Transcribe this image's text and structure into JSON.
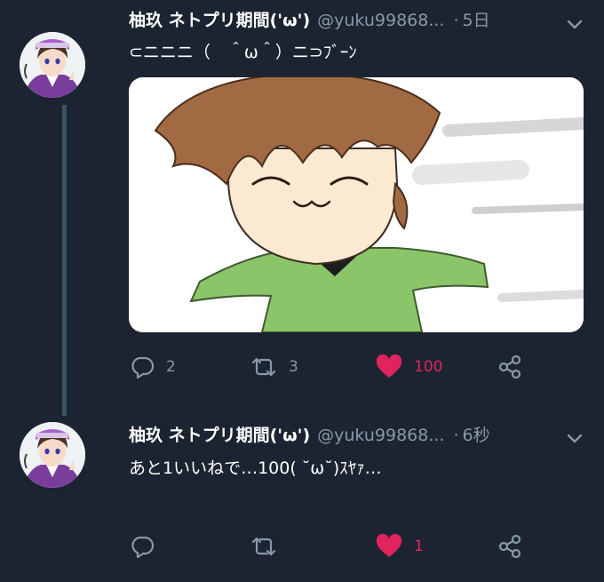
{
  "tweets": [
    {
      "name": "柚玖 ネトプリ期間('ω')",
      "handle": "@yuku99868...",
      "dot": "·",
      "time": "5日",
      "text": "⊂ニニニ（　＾ω＾）ニ⊃ﾌﾞｰﾝ",
      "has_media": true,
      "replies": "2",
      "retweets": "3",
      "likes": "100",
      "liked": true
    },
    {
      "name": "柚玖 ネトプリ期間('ω')",
      "handle": "@yuku99868...",
      "dot": "·",
      "time": "6秒",
      "text": "あと1いいねで…100( ˘ω˘)ｽﾔｧ…",
      "has_media": false,
      "replies": "",
      "retweets": "",
      "likes": "1",
      "liked": true
    }
  ],
  "colors": {
    "background": "#1b2430",
    "secondary_text": "#8899a6",
    "like_pink": "#e0245e",
    "thread_line": "#3d5466"
  },
  "icons": [
    "chevron-down-icon",
    "reply-icon",
    "retweet-icon",
    "heart-icon",
    "share-icon"
  ]
}
